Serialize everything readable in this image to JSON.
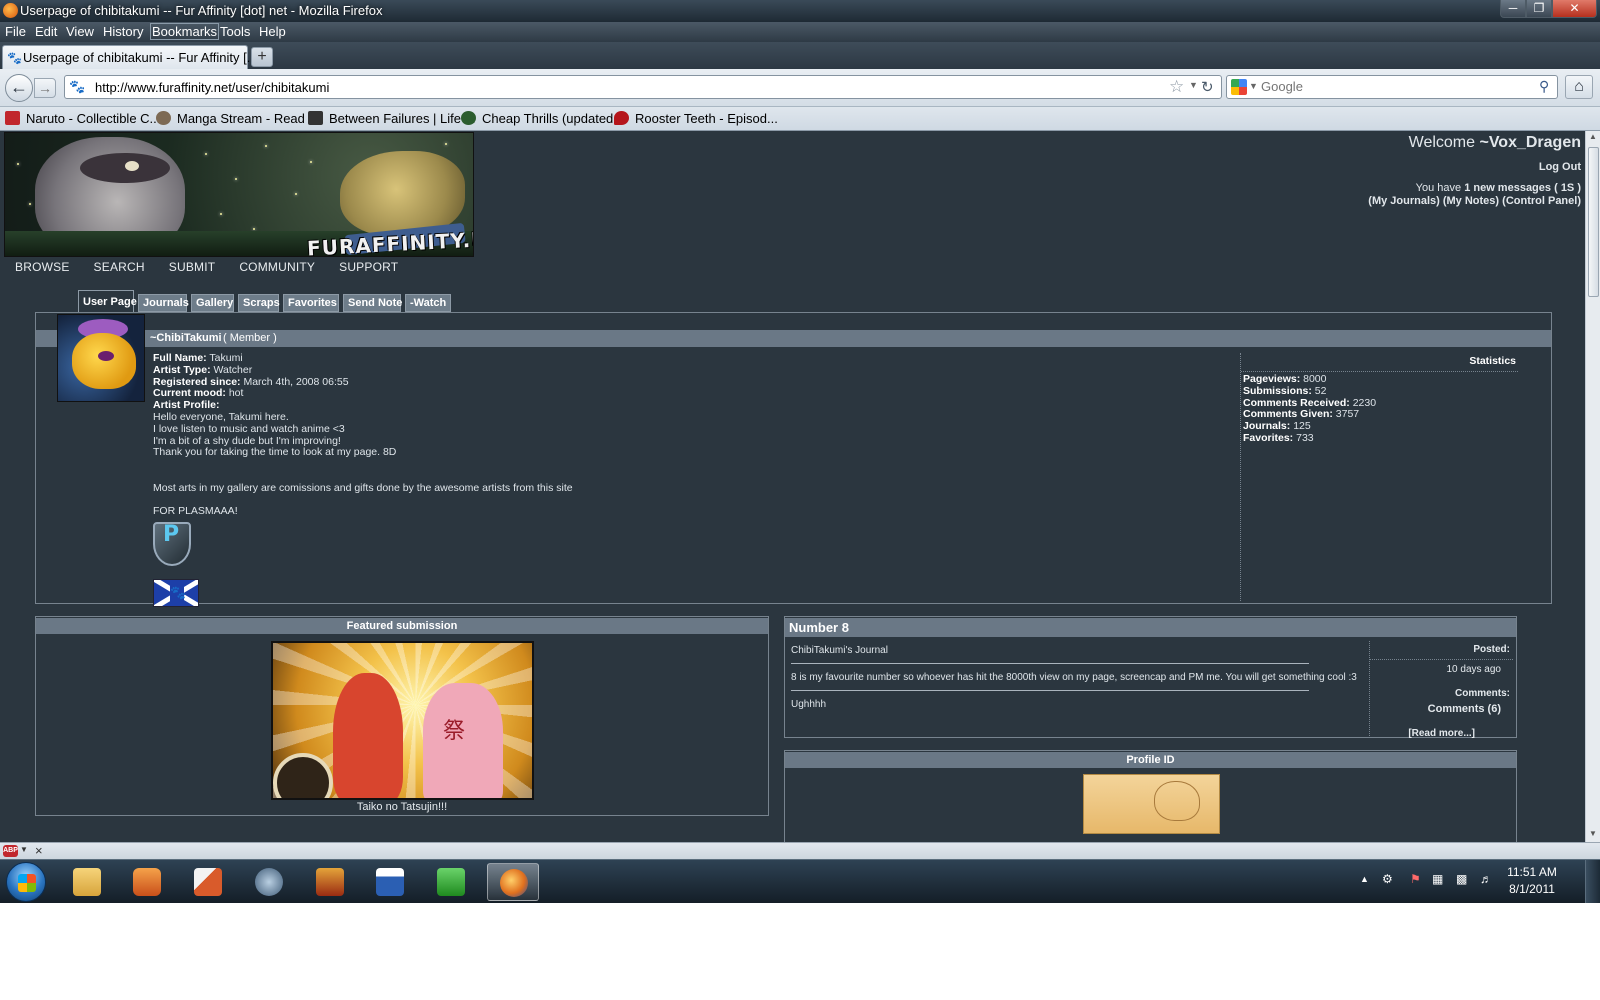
{
  "window": {
    "title": "Userpage of chibitakumi -- Fur Affinity [dot] net - Mozilla Firefox"
  },
  "menu": {
    "items": [
      "File",
      "Edit",
      "View",
      "History",
      "Bookmarks",
      "Tools",
      "Help"
    ]
  },
  "tabs": {
    "active_label": "Userpage of chibitakumi -- Fur Affinity [...",
    "new_tab_label": "+"
  },
  "nav": {
    "url": "http://www.furaffinity.net/user/chibitakumi",
    "search_placeholder": "Google"
  },
  "bookmarks": [
    {
      "label": "Naruto - Collectible C...",
      "color": "#c1272d"
    },
    {
      "label": "Manga Stream - Read ...",
      "color": "#7d6a54"
    },
    {
      "label": "Between Failures | Life ...",
      "color": "#333333"
    },
    {
      "label": "Cheap Thrills (updated...",
      "color": "#2c5d2e"
    },
    {
      "label": "Rooster Teeth - Episod...",
      "color": "#b5151b"
    }
  ],
  "banner": {
    "logo_text": "FURAFFINITY.NET"
  },
  "welcome": {
    "prefix": "Welcome",
    "user": "~Vox_Dragen",
    "logout": "Log Out",
    "messages_prefix": "You have",
    "messages_count": "1 new messages",
    "messages_code": "( 1S )",
    "links": [
      "(My Journals)",
      "(My Notes)",
      "(Control Panel)"
    ]
  },
  "site_nav": [
    "BROWSE",
    "SEARCH",
    "SUBMIT",
    "COMMUNITY",
    "SUPPORT"
  ],
  "user_tabs": [
    "User Page",
    "Journals",
    "Gallery",
    "Scraps",
    "Favorites",
    "Send Note",
    "-Watch"
  ],
  "profile": {
    "username": "~ChibiTakumi",
    "role": "( Member )",
    "fields": [
      {
        "label": "Full Name:",
        "value": "Takumi"
      },
      {
        "label": "Artist Type:",
        "value": "Watcher"
      },
      {
        "label": "Registered since:",
        "value": "March 4th, 2008 06:55"
      },
      {
        "label": "Current mood:",
        "value": "hot"
      },
      {
        "label": "Artist Profile:",
        "value": ""
      }
    ],
    "bio": [
      "Hello everyone, Takumi here.",
      "I love listen to music and watch anime <3",
      "I'm a bit of a shy dude but I'm improving!",
      "Thank you for taking the time to look at my page. 8D",
      "",
      "",
      "Most arts in my gallery are comissions and gifts done by the awesome artists from this site",
      "",
      "FOR PLASMAAA!"
    ],
    "badge_letter": "P"
  },
  "statistics": {
    "title": "Statistics",
    "items": [
      {
        "label": "Pageviews:",
        "value": "8000"
      },
      {
        "label": "Submissions:",
        "value": "52"
      },
      {
        "label": "Comments Received:",
        "value": "2230"
      },
      {
        "label": "Comments Given:",
        "value": "3757"
      },
      {
        "label": "Journals:",
        "value": "125"
      },
      {
        "label": "Favorites:",
        "value": "733"
      }
    ]
  },
  "featured": {
    "title": "Featured submission",
    "caption": "Taiko no Tatsujin!!!",
    "kanji": "祭"
  },
  "journal": {
    "title": "Number 8",
    "source": "ChibiTakumi's Journal",
    "body": "8 is my favourite number so whoever has hit the 8000th view on my page, screencap and PM me. You will get something cool :3",
    "sign": "Ughhhh",
    "posted_label": "Posted:",
    "posted_value": "10 days ago",
    "comments_label": "Comments:",
    "comments_value": "Comments (6)",
    "read_more": "[Read more...]"
  },
  "profile_id": {
    "title": "Profile ID"
  },
  "addon_bar": {
    "abp_label": "ABP"
  },
  "taskbar": {
    "apps": [
      {
        "name": "explorer",
        "color": "#e8b44a"
      },
      {
        "name": "media-player",
        "color": "#e06a2a"
      },
      {
        "name": "paint",
        "color": "#d95b2b"
      },
      {
        "name": "starcraft",
        "color": "#6c8aa6"
      },
      {
        "name": "game",
        "color": "#b5401c"
      },
      {
        "name": "word",
        "color": "#2b5fb3"
      },
      {
        "name": "media-center",
        "color": "#3aa83a"
      },
      {
        "name": "firefox",
        "color": "#e0701e"
      }
    ],
    "clock_time": "11:51 AM",
    "clock_date": "8/1/2011"
  }
}
